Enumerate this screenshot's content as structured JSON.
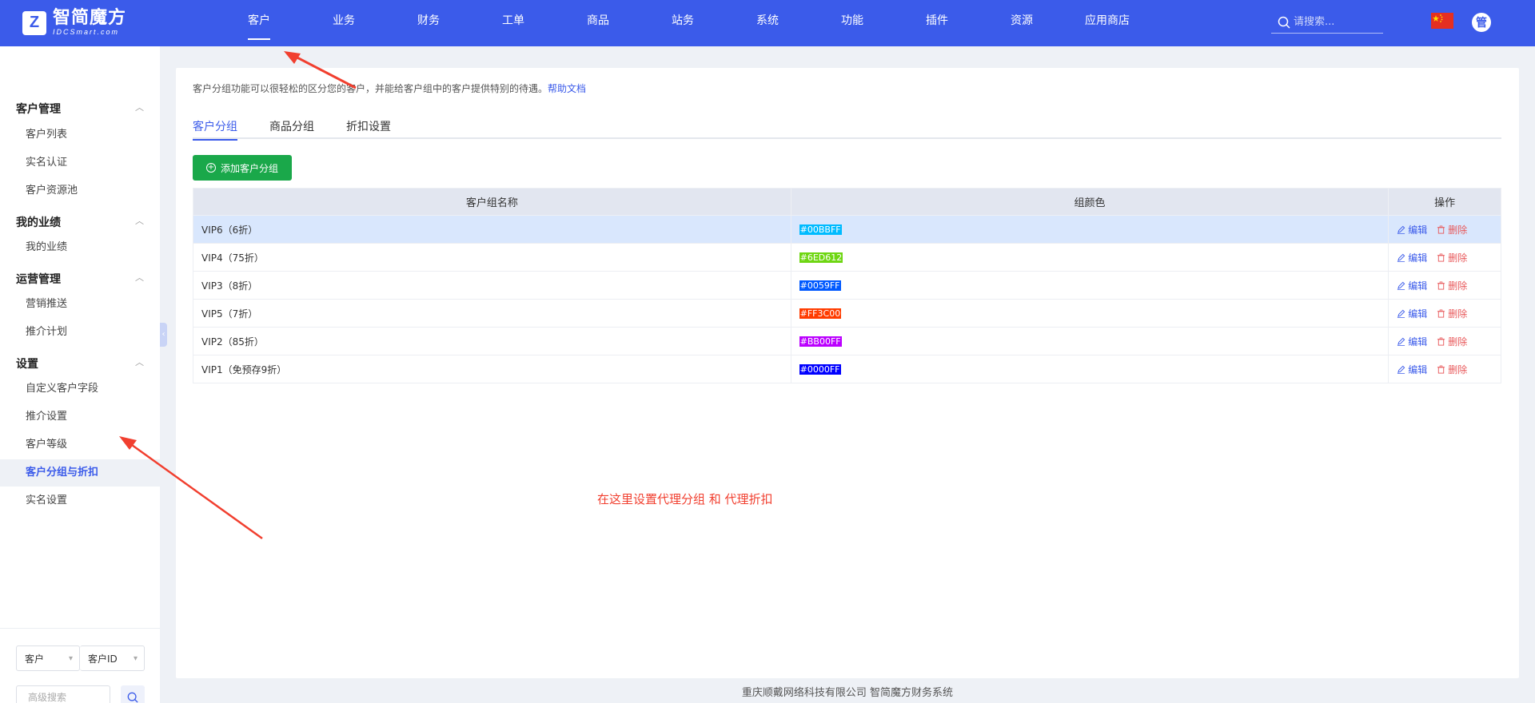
{
  "app": {
    "logo_main": "智简魔方",
    "logo_sub": "IDCSmart.com"
  },
  "nav": {
    "items": [
      "客户",
      "业务",
      "财务",
      "工单",
      "商品",
      "站务",
      "系统",
      "功能",
      "插件",
      "资源",
      "应用商店"
    ],
    "active": "客户",
    "search_placeholder": "请搜索..."
  },
  "user": {
    "avatar_label": "管"
  },
  "sidebar": {
    "groups": [
      {
        "title": "客户管理",
        "items": [
          "客户列表",
          "实名认证",
          "客户资源池"
        ]
      },
      {
        "title": "我的业绩",
        "items": [
          "我的业绩"
        ]
      },
      {
        "title": "运营管理",
        "items": [
          "营销推送",
          "推介计划"
        ]
      },
      {
        "title": "设置",
        "items": [
          "自定义客户字段",
          "推介设置",
          "客户等级",
          "客户分组与折扣",
          "实名设置"
        ]
      }
    ],
    "active_item": "客户分组与折扣",
    "filter_type": "客户",
    "filter_field": "客户ID",
    "adv_search_placeholder": "高级搜索"
  },
  "main": {
    "description": "客户分组功能可以很轻松的区分您的客户，并能给客户组中的客户提供特别的待遇。",
    "help_link": "帮助文档",
    "tabs": [
      "客户分组",
      "商品分组",
      "折扣设置"
    ],
    "active_tab": "客户分组",
    "add_button": "添加客户分组",
    "table": {
      "headers": [
        "客户组名称",
        "组颜色",
        "操作"
      ],
      "rows": [
        {
          "name": "VIP6（6折）",
          "color": "#00BBFF"
        },
        {
          "name": "VIP4（75折）",
          "color": "#6ED612"
        },
        {
          "name": "VIP3（8折）",
          "color": "#0059FF"
        },
        {
          "name": "VIP5（7折）",
          "color": "#FF3C00"
        },
        {
          "name": "VIP2（85折）",
          "color": "#BB00FF"
        },
        {
          "name": "VIP1（免预存9折）",
          "color": "#0000FF"
        }
      ],
      "edit_label": "编辑",
      "delete_label": "删除"
    },
    "annotation": "在这里设置代理分组 和 代理折扣"
  },
  "footer": "重庆顺戴网络科技有限公司 智简魔方财务系统",
  "colors": {
    "brand": "#3b5bea",
    "add_button": "#1aa84a",
    "delete": "#e8585a",
    "annotation": "#f13f2f"
  }
}
